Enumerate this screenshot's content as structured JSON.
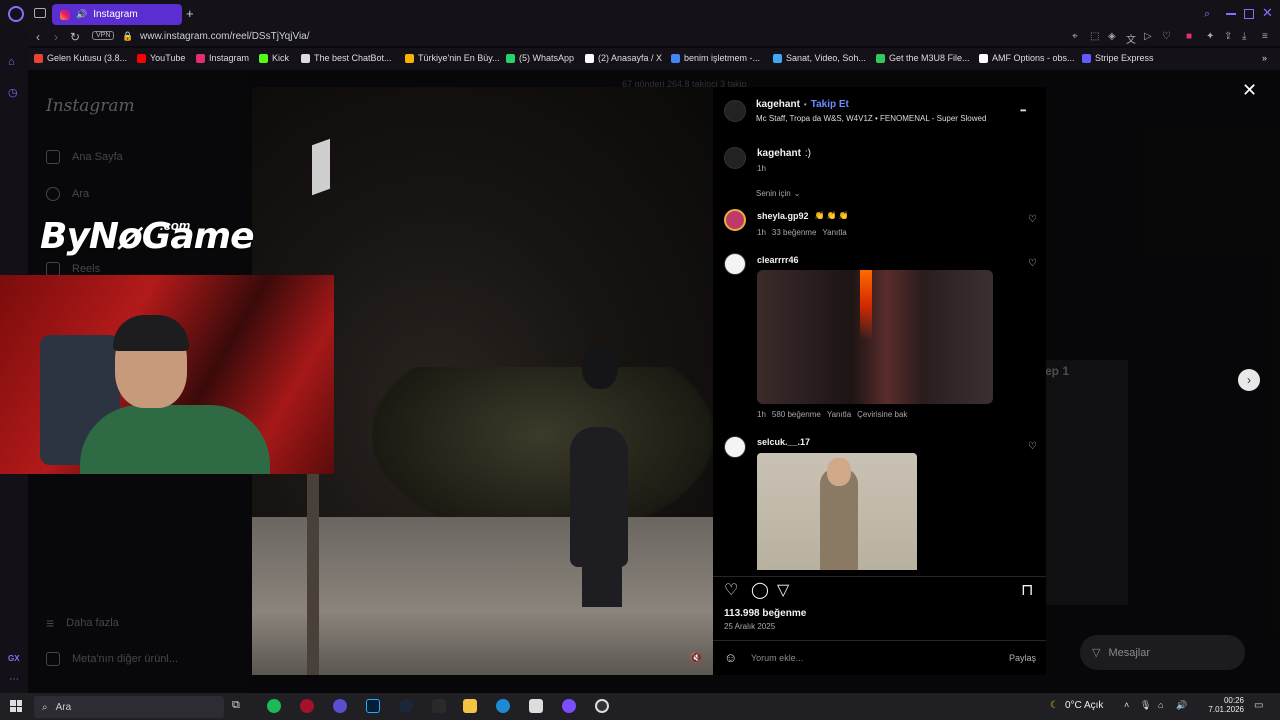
{
  "browser": {
    "tab_title": "Instagram",
    "new_tab": "+",
    "vpn_label": "VPN",
    "url": "www.instagram.com/reel/DSsTjYqjVia/",
    "bookmarks": [
      {
        "label": "Gelen Kutusu (3.8...",
        "color": "#ea4335"
      },
      {
        "label": "YouTube",
        "color": "#ff0000"
      },
      {
        "label": "Instagram",
        "color": "#e1306c"
      },
      {
        "label": "Kick",
        "color": "#53fc18"
      },
      {
        "label": "The best ChatBot...",
        "color": "#dddddd"
      },
      {
        "label": "Türkiye'nin En Büy...",
        "color": "#f4b400"
      },
      {
        "label": "(5) WhatsApp",
        "color": "#25d366"
      },
      {
        "label": "(2) Anasayfa / X",
        "color": "#ffffff"
      },
      {
        "label": "benim işletmem -...",
        "color": "#4285f4"
      },
      {
        "label": "Sanat, Video, Soh...",
        "color": "#3fa9f5"
      },
      {
        "label": "Get the M3U8 File...",
        "color": "#34c759"
      },
      {
        "label": "AMF Options - obs...",
        "color": "#ffffff"
      },
      {
        "label": "Stripe Express",
        "color": "#635bff"
      }
    ],
    "rail_label": "GX"
  },
  "instagram": {
    "logo": "Instagram",
    "sidebar": [
      {
        "label": "Ana Sayfa"
      },
      {
        "label": "Ara"
      },
      {
        "label": "Reels"
      }
    ],
    "more_label": "Daha fazla",
    "meta_label": "Meta'nın diğer ürünl...",
    "bg_stats": "67 gönderi    264,8 takipçi    3 takip",
    "bg_ep": "ep 1",
    "messages_label": "Mesajlar"
  },
  "overlay": {
    "brand": "ByNøGame",
    "brand_suffix": ".com"
  },
  "post": {
    "username": "kagehant",
    "dot": "•",
    "follow_label": "Takip Et",
    "audio": "Mc Staff, Tropa da W&S, W4V1Z • FENOMENAL - Super Slowed",
    "more": "•••",
    "caption_user": "kagehant",
    "caption_text": ":)",
    "caption_time": "1h",
    "for_you": "Senin için",
    "comments": [
      {
        "user": "sheyla.gp92",
        "text": "👏 👏 👏",
        "time": "1h",
        "likes": "33 beğenme",
        "reply": "Yanıtla",
        "avatar_color": "#c0396b"
      },
      {
        "user": "clearrrr46",
        "text": "",
        "time": "1h",
        "likes": "580 beğenme",
        "reply": "Yanıtla",
        "translate": "Çevirisine bak",
        "avatar_color": "#ffffff"
      },
      {
        "user": "selcuk.__.17",
        "text": "",
        "avatar_color": "#ffffff"
      }
    ],
    "likes": "113.998 beğenme",
    "date": "25 Aralık 2025",
    "comment_placeholder": "Yorum ekle...",
    "share_label": "Paylaş"
  },
  "taskbar": {
    "search": "Ara",
    "weather": "0°C  Açık",
    "time": "00:26",
    "date": "7.01.2026"
  }
}
